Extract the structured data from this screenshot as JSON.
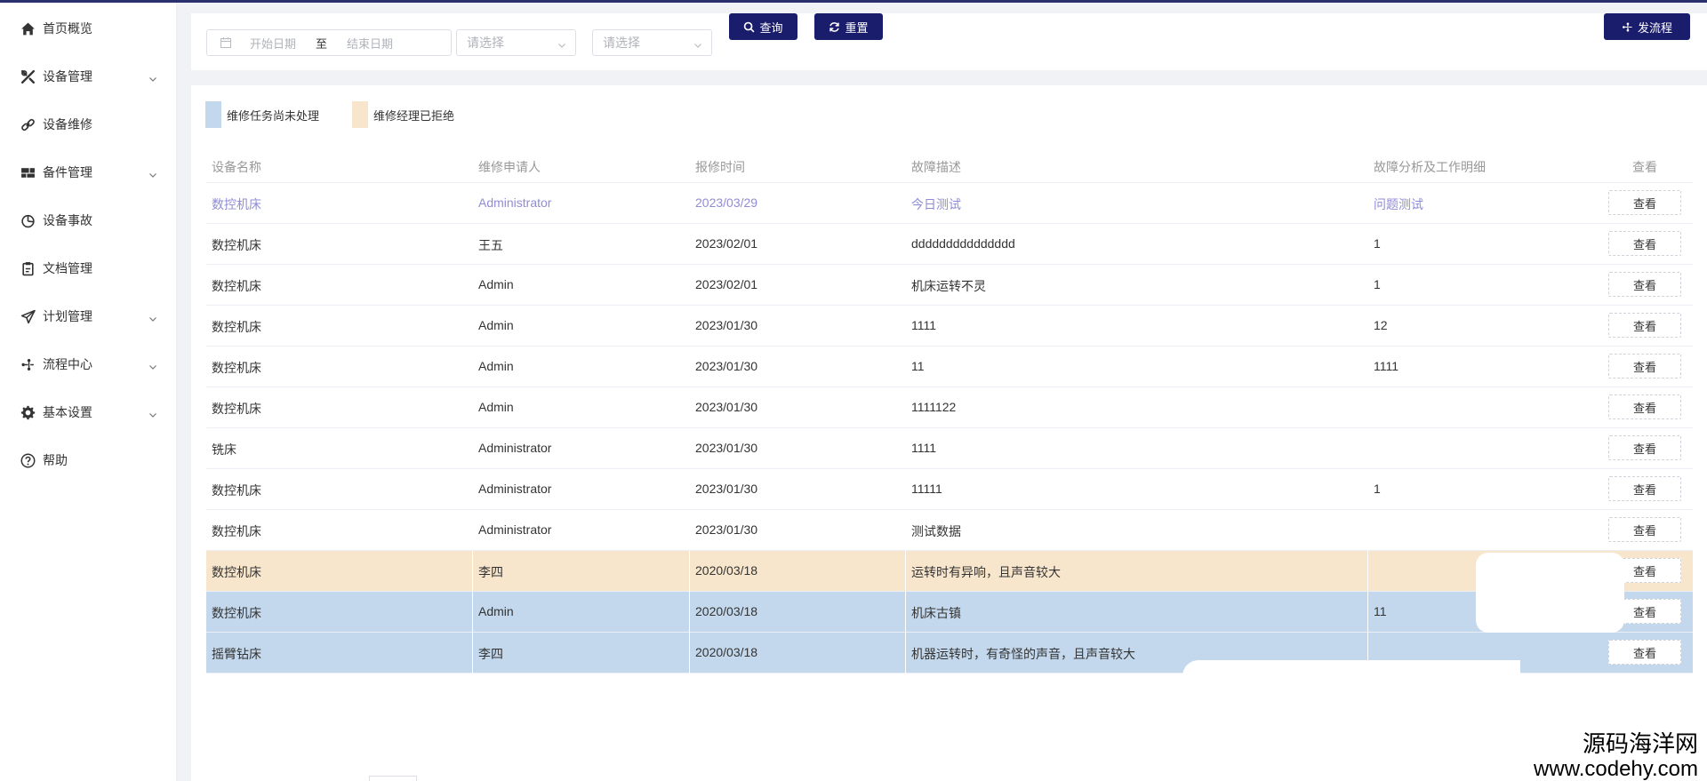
{
  "sidebar": {
    "items": [
      {
        "label": "首页概览",
        "icon": "home-icon",
        "expandable": false
      },
      {
        "label": "设备管理",
        "icon": "tools-icon",
        "expandable": true
      },
      {
        "label": "设备维修",
        "icon": "link-icon",
        "expandable": false
      },
      {
        "label": "备件管理",
        "icon": "blocks-icon",
        "expandable": true
      },
      {
        "label": "设备事故",
        "icon": "pie-icon",
        "expandable": false
      },
      {
        "label": "文档管理",
        "icon": "clipboard-icon",
        "expandable": false
      },
      {
        "label": "计划管理",
        "icon": "send-icon",
        "expandable": true
      },
      {
        "label": "流程中心",
        "icon": "flow-icon",
        "expandable": true
      },
      {
        "label": "基本设置",
        "icon": "gear-icon",
        "expandable": true
      },
      {
        "label": "帮助",
        "icon": "help-icon",
        "expandable": false
      }
    ]
  },
  "toolbar": {
    "start_placeholder": "开始日期",
    "range_separator": "至",
    "end_placeholder": "结束日期",
    "select1_placeholder": "请选择",
    "select2_placeholder": "请选择",
    "query_label": "查询",
    "reset_label": "重置",
    "start_flow_label": "发流程"
  },
  "legend": {
    "pending_label": "维修任务尚未处理",
    "pending_color": "#c3d8ec",
    "rejected_label": "维修经理已拒绝",
    "rejected_color": "#f8e6cc"
  },
  "table": {
    "headers": [
      "设备名称",
      "维修申请人",
      "报修时间",
      "故障描述",
      "故障分析及工作明细",
      "查看"
    ],
    "view_label": "查看",
    "rows": [
      {
        "device": "数控机床",
        "applicant": "Administrator",
        "date": "2023/03/29",
        "desc": "今日测试",
        "analysis": "问题测试"
      },
      {
        "device": "数控机床",
        "applicant": "王五",
        "date": "2023/02/01",
        "desc": "ddddddddddddddd",
        "analysis": "1"
      },
      {
        "device": "数控机床",
        "applicant": "Admin",
        "date": "2023/02/01",
        "desc": "机床运转不灵",
        "analysis": "1"
      },
      {
        "device": "数控机床",
        "applicant": "Admin",
        "date": "2023/01/30",
        "desc": "1111",
        "analysis": "12"
      },
      {
        "device": "数控机床",
        "applicant": "Admin",
        "date": "2023/01/30",
        "desc": "11",
        "analysis": "1111"
      },
      {
        "device": "数控机床",
        "applicant": "Admin",
        "date": "2023/01/30",
        "desc": "1111122",
        "analysis": ""
      },
      {
        "device": "铣床",
        "applicant": "Administrator",
        "date": "2023/01/30",
        "desc": "1111",
        "analysis": ""
      },
      {
        "device": "数控机床",
        "applicant": "Administrator",
        "date": "2023/01/30",
        "desc": "11111",
        "analysis": "1"
      },
      {
        "device": "数控机床",
        "applicant": "Administrator",
        "date": "2023/01/30",
        "desc": "测试数据",
        "analysis": ""
      },
      {
        "device": "数控机床",
        "applicant": "李四",
        "date": "2020/03/18",
        "desc": "运转时有异响，且声音较大",
        "analysis": ""
      },
      {
        "device": "数控机床",
        "applicant": "Admin",
        "date": "2020/03/18",
        "desc": "机床古镇",
        "analysis": "11"
      },
      {
        "device": "摇臂钻床",
        "applicant": "李四",
        "date": "2020/03/18",
        "desc": "机器运转时，有奇怪的声音，且声音较大",
        "analysis": ""
      }
    ]
  },
  "watermark": {
    "line1": "源码海洋网",
    "line2": "www.codehy.com"
  }
}
